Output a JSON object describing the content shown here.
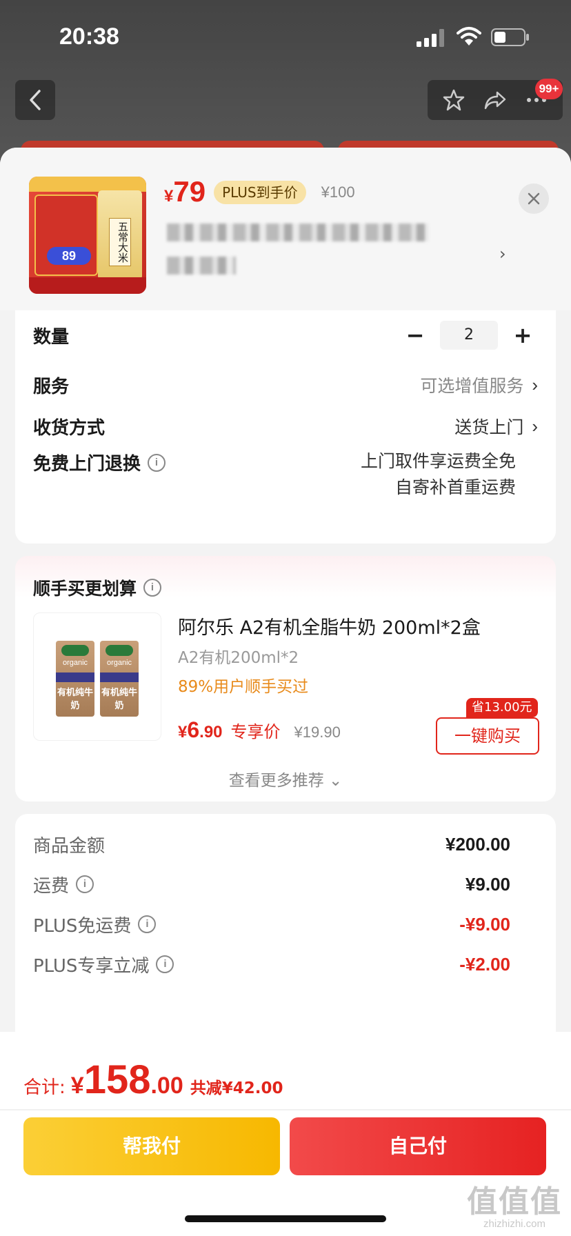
{
  "status_bar": {
    "time": "20:38"
  },
  "nav": {
    "badge": "99+"
  },
  "product": {
    "thumb_price": "89",
    "thumb_label": "五常大米",
    "currency": "¥",
    "price": "79",
    "plus_tag": "PLUS到手价",
    "original_price": "¥100"
  },
  "options": {
    "quantity_label": "数量",
    "quantity_minus": "−",
    "quantity_value": "2",
    "quantity_plus": "+",
    "service_label": "服务",
    "service_value": "可选增值服务",
    "delivery_label": "收货方式",
    "delivery_value": "送货上门",
    "return_label": "免费上门退换",
    "return_line1": "上门取件享运费全免",
    "return_line2": "自寄补首重运费"
  },
  "recommendation": {
    "title": "顺手买更划算",
    "product_name": "阿尔乐 A2有机全脂牛奶 200ml*2盒",
    "spec": "A2有机200ml*2",
    "buyers_pct": "89%用户顺手买过",
    "currency": "¥",
    "price_int": "6",
    "price_dec": ".90",
    "price_label": "专享价",
    "original_price": "¥19.90",
    "save_tag": "省13.00元",
    "buy_button": "一键购买",
    "more": "查看更多推荐 ⌄",
    "carton_brand": "organic",
    "carton_text": "有机纯牛奶"
  },
  "totals": {
    "rows": [
      {
        "label": "商品金额",
        "value": "¥200.00"
      },
      {
        "label": "运费",
        "value": "¥9.00"
      },
      {
        "label": "PLUS免运费",
        "value": "-¥9.00"
      },
      {
        "label": "PLUS专享立减",
        "value": "-¥2.00"
      }
    ]
  },
  "footer": {
    "sum_label": "合计:",
    "currency": "¥",
    "sum_int": "158",
    "sum_dec": ".00",
    "saved": "共减¥42.00",
    "help_pay": "帮我付",
    "self_pay": "自己付"
  },
  "watermark": {
    "big": "值值值",
    "small": "zhizhizhi.com"
  },
  "colors": {
    "accent_red": "#e1251b",
    "help_yellow": "#f7b800",
    "plus_gold": "#f8e2a6",
    "pct_orange": "#e88a1a"
  }
}
